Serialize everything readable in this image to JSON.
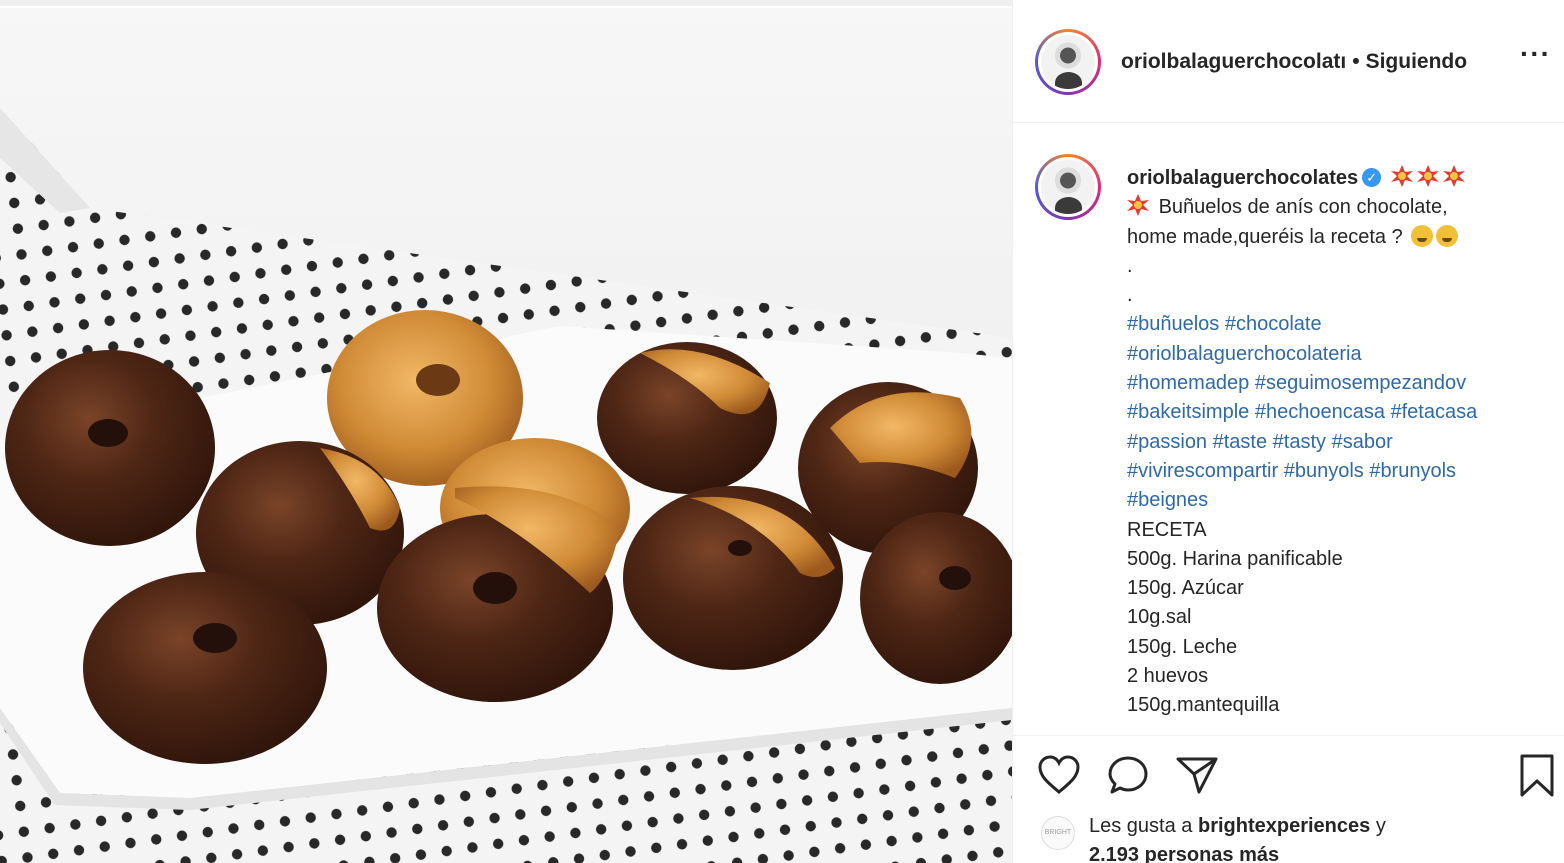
{
  "post": {
    "username_header": "oriolbalaguerchocolatı",
    "separator": "•",
    "follow_status": "Siguiendo",
    "more_label": "···",
    "photo_alt": "Buñuelos de anís con chocolate"
  },
  "caption": {
    "username": "oriolbalaguerchocolates",
    "verified_glyph": "✓",
    "line1": "Buñuelos de anís con chocolate,",
    "line2": "home made,queréis la receta ?",
    "dot1": ".",
    "dot2": ".",
    "hashtags": [
      "#buñuelos #chocolate",
      "#oriolbalaguerchocolateria",
      "#homemadep #seguimosempezandov",
      "#bakeitsimple #hechoencasa #fetacasa",
      "#passion #taste #tasty #sabor",
      "#vivirescompartir #bunyols #brunyols",
      "#beignes"
    ],
    "recipe": [
      "RECETA",
      "500g. Harina panificable",
      "150g. Azúcar",
      "10g.sal",
      "150g. Leche",
      "2 huevos",
      "150g.mantequilla"
    ]
  },
  "likes": {
    "prefix": "Les gusta a",
    "user": "brightexperiences",
    "suffix": "y",
    "count_text": "2.193 personas más",
    "mini_avatar_label": "BRIGHT"
  },
  "icons": [
    "heart-icon",
    "comment-icon",
    "share-icon",
    "bookmark-icon"
  ],
  "colors": {
    "hashtag": "#2f6aa7",
    "verified": "#3897f0",
    "chocolate": "#4a2414",
    "fried_dough": "#c98a3c"
  }
}
